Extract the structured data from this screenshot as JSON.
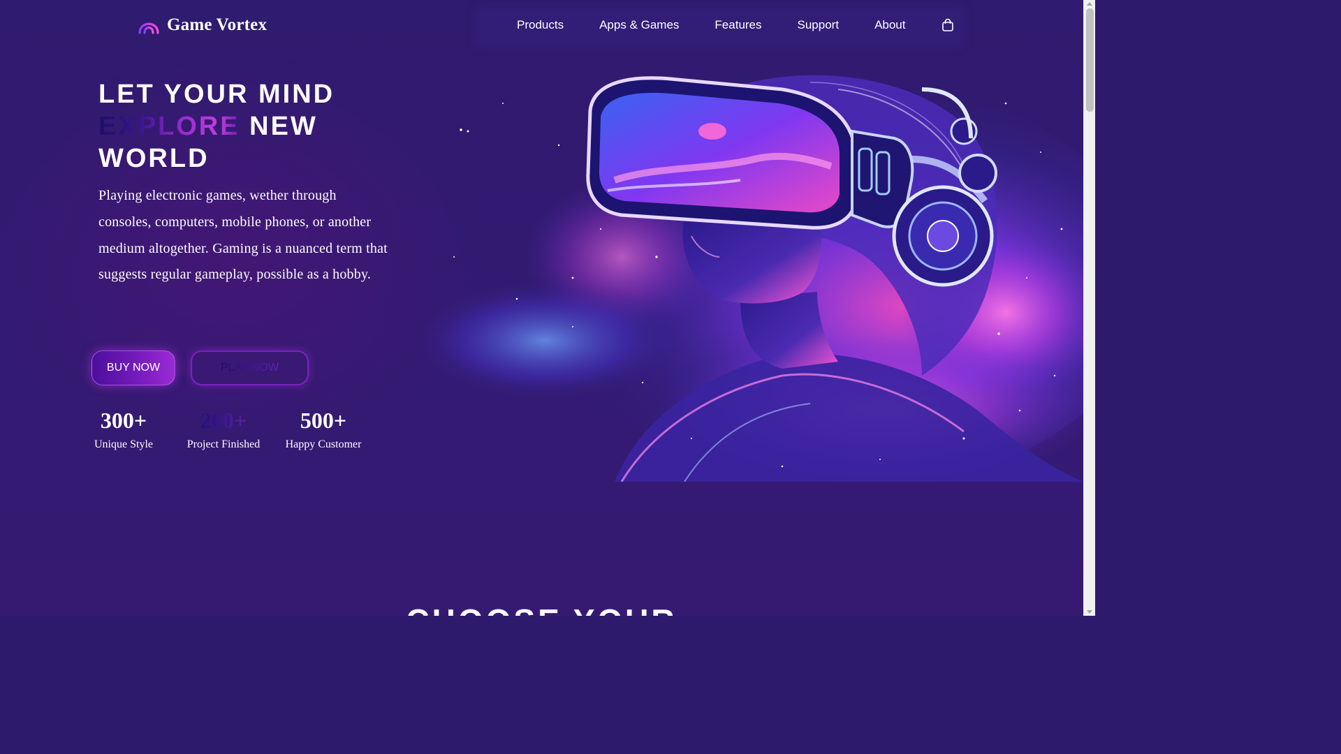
{
  "brand": {
    "name": "Game Vortex",
    "icon": "arc-logo-icon"
  },
  "nav": {
    "items": [
      {
        "label": "Products"
      },
      {
        "label": "Apps & Games"
      },
      {
        "label": "Features"
      },
      {
        "label": "Support"
      },
      {
        "label": "About"
      }
    ],
    "cart_icon": "shopping-bag-icon"
  },
  "hero": {
    "title_line1": "LET YOUR MIND",
    "title_highlight": "EXPLORE",
    "title_line2_rest": " NEW",
    "title_line3": "WORLD",
    "description": "Playing electronic games, wether through consoles, computers, mobile phones, or another medium altogether. Gaming is a nuanced term that suggests regular gameplay, possible as a hobby.",
    "buy_button": "BUY NOW",
    "play_button": "PLAY NOW",
    "image": "vr-headset-woman-illustration"
  },
  "stats": [
    {
      "value": "300+",
      "label": "Unique Style"
    },
    {
      "value": "200+",
      "label": "Project Finished"
    },
    {
      "value": "500+",
      "label": "Happy Customer"
    }
  ],
  "next_section": {
    "heading": "CHOOSE YOUR"
  },
  "colors": {
    "background": "#2e1a6c",
    "accent_purple": "#7a1cc0",
    "accent_pink": "#c23ee0",
    "text": "#ffffff"
  }
}
